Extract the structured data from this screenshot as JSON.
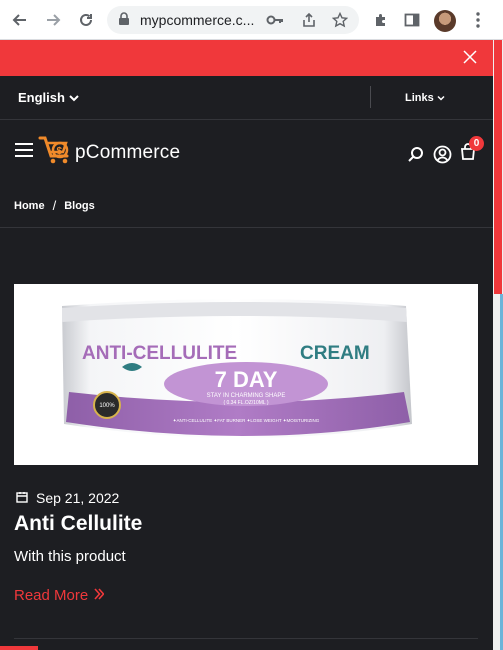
{
  "browser": {
    "url": "mypcommerce.c...",
    "icons": [
      "back-icon",
      "forward-icon",
      "reload-icon",
      "lock-icon",
      "key-icon",
      "share-icon",
      "star-icon",
      "extensions-icon",
      "sidepanel-icon",
      "avatar",
      "menu-icon"
    ]
  },
  "topbar": {
    "language": "English",
    "links": "Links"
  },
  "header": {
    "logo_text": "pCommerce",
    "cart_count": "0"
  },
  "breadcrumb": {
    "home": "Home",
    "separator": "/",
    "current": "Blogs"
  },
  "post": {
    "image": {
      "line1a": "ANTI-CELLULITE",
      "line1b": "CREAM",
      "line2": "7 DAY",
      "line3": "STAY IN CHARMING SHAPE",
      "line4": "( 0.34 FL.OZ/10ML )",
      "footer": "✦ANTI-CELLULITE   ✦FAT BURNER   ✦LOSE WEIGHT   ✦MOISTURIZING",
      "seal": "100%"
    },
    "date": "Sep 21, 2022",
    "title": "Anti Cellulite",
    "excerpt": "With this product",
    "read_more": "Read More"
  },
  "colors": {
    "accent": "#f0383b",
    "background": "#1d1e22",
    "divider": "#34353a"
  }
}
